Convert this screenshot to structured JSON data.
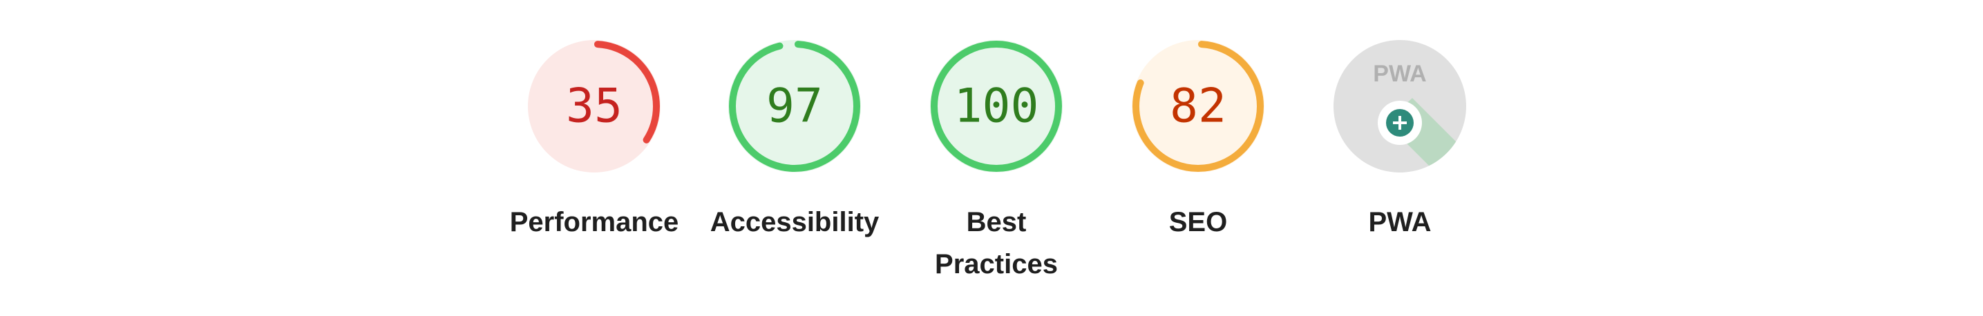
{
  "gauges": [
    {
      "id": "performance",
      "score": "35",
      "value": 35,
      "label": "Performance",
      "color": "#e8453c",
      "bg": "#fce8e6",
      "text_color": "#c5221f"
    },
    {
      "id": "accessibility",
      "score": "97",
      "value": 97,
      "label": "Accessibility",
      "color": "#4ccb6a",
      "bg": "#e6f6ea",
      "text_color": "#2f7d1e"
    },
    {
      "id": "best-practices",
      "score": "100",
      "value": 100,
      "label": "Best Practices",
      "color": "#4ccb6a",
      "bg": "#e6f6ea",
      "text_color": "#2f7d1e"
    },
    {
      "id": "seo",
      "score": "82",
      "value": 82,
      "label": "SEO",
      "color": "#f4ac3c",
      "bg": "#fff5e8",
      "text_color": "#c33300"
    }
  ],
  "pwa": {
    "label": "PWA",
    "badge_text": "PWA",
    "icon": "pwa-plus-icon",
    "bg": "#e0e0e0",
    "badge_color": "#b0b0b0",
    "accent": "#2e8b7b"
  }
}
